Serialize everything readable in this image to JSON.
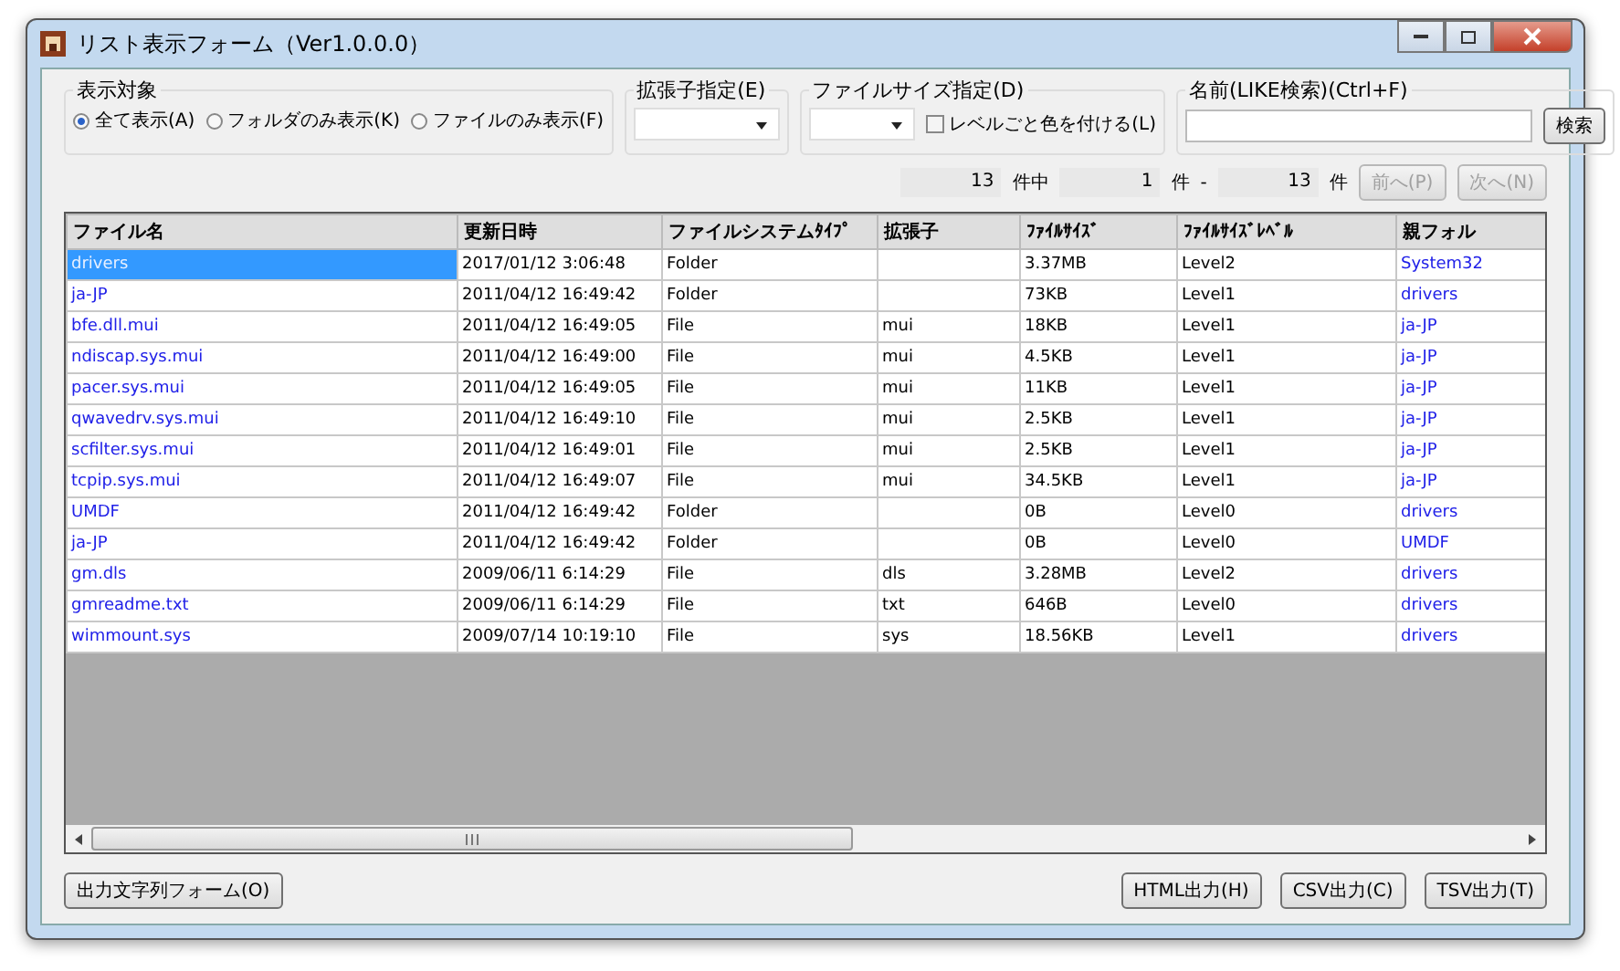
{
  "window": {
    "title": "リスト表示フォーム（Ver1.0.0.0）"
  },
  "display_target": {
    "label": "表示対象",
    "options": [
      {
        "label": "全て表示(A)",
        "selected": true
      },
      {
        "label": "フォルダのみ表示(K)",
        "selected": false
      },
      {
        "label": "ファイルのみ表示(F)",
        "selected": false
      }
    ]
  },
  "extension_filter": {
    "label": "拡張子指定(E)"
  },
  "file_size_filter": {
    "label": "ファイルサイズ指定(D)"
  },
  "color_by_level": {
    "label": "レベルごと色を付ける(L)",
    "checked": false
  },
  "name_search": {
    "label": "名前(LIKE検索)(Ctrl+F)",
    "button": "検索"
  },
  "pager": {
    "total": "13",
    "total_unit": "件中",
    "from": "1",
    "from_unit": "件",
    "dash": "-",
    "to": "13",
    "to_unit": "件",
    "prev": {
      "label": "前へ(P)",
      "disabled": true
    },
    "next": {
      "label": "次へ(N)",
      "disabled": true
    }
  },
  "table": {
    "columns": [
      "ファイル名",
      "更新日時",
      "ファイルシステムﾀｲﾌﾟ",
      "拡張子",
      "ﾌｧｲﾙｻｲｽﾞ",
      "ﾌｧｲﾙｻｲｽﾞﾚﾍﾞﾙ",
      "親フォル"
    ],
    "rows": [
      {
        "selected": true,
        "cells": [
          "drivers",
          "2017/01/12 3:06:48",
          "Folder",
          "",
          "3.37MB",
          "Level2",
          "System32"
        ]
      },
      {
        "selected": false,
        "cells": [
          "ja-JP",
          "2011/04/12 16:49:42",
          "Folder",
          "",
          "73KB",
          "Level1",
          "drivers"
        ]
      },
      {
        "selected": false,
        "cells": [
          "bfe.dll.mui",
          "2011/04/12 16:49:05",
          "File",
          "mui",
          "18KB",
          "Level1",
          "ja-JP"
        ]
      },
      {
        "selected": false,
        "cells": [
          "ndiscap.sys.mui",
          "2011/04/12 16:49:00",
          "File",
          "mui",
          "4.5KB",
          "Level1",
          "ja-JP"
        ]
      },
      {
        "selected": false,
        "cells": [
          "pacer.sys.mui",
          "2011/04/12 16:49:05",
          "File",
          "mui",
          "11KB",
          "Level1",
          "ja-JP"
        ]
      },
      {
        "selected": false,
        "cells": [
          "qwavedrv.sys.mui",
          "2011/04/12 16:49:10",
          "File",
          "mui",
          "2.5KB",
          "Level1",
          "ja-JP"
        ]
      },
      {
        "selected": false,
        "cells": [
          "scfilter.sys.mui",
          "2011/04/12 16:49:01",
          "File",
          "mui",
          "2.5KB",
          "Level1",
          "ja-JP"
        ]
      },
      {
        "selected": false,
        "cells": [
          "tcpip.sys.mui",
          "2011/04/12 16:49:07",
          "File",
          "mui",
          "34.5KB",
          "Level1",
          "ja-JP"
        ]
      },
      {
        "selected": false,
        "cells": [
          "UMDF",
          "2011/04/12 16:49:42",
          "Folder",
          "",
          "0B",
          "Level0",
          "drivers"
        ]
      },
      {
        "selected": false,
        "cells": [
          "ja-JP",
          "2011/04/12 16:49:42",
          "Folder",
          "",
          "0B",
          "Level0",
          "UMDF"
        ]
      },
      {
        "selected": false,
        "cells": [
          "gm.dls",
          "2009/06/11 6:14:29",
          "File",
          "dls",
          "3.28MB",
          "Level2",
          "drivers"
        ]
      },
      {
        "selected": false,
        "cells": [
          "gmreadme.txt",
          "2009/06/11 6:14:29",
          "File",
          "txt",
          "646B",
          "Level0",
          "drivers"
        ]
      },
      {
        "selected": false,
        "cells": [
          "wimmount.sys",
          "2009/07/14 10:19:10",
          "File",
          "sys",
          "18.56KB",
          "Level1",
          "drivers"
        ]
      }
    ]
  },
  "output_string_button": "出力文字列フォーム(O)",
  "export_buttons": [
    "HTML出力(H)",
    "CSV出力(C)",
    "TSV出力(T)"
  ]
}
